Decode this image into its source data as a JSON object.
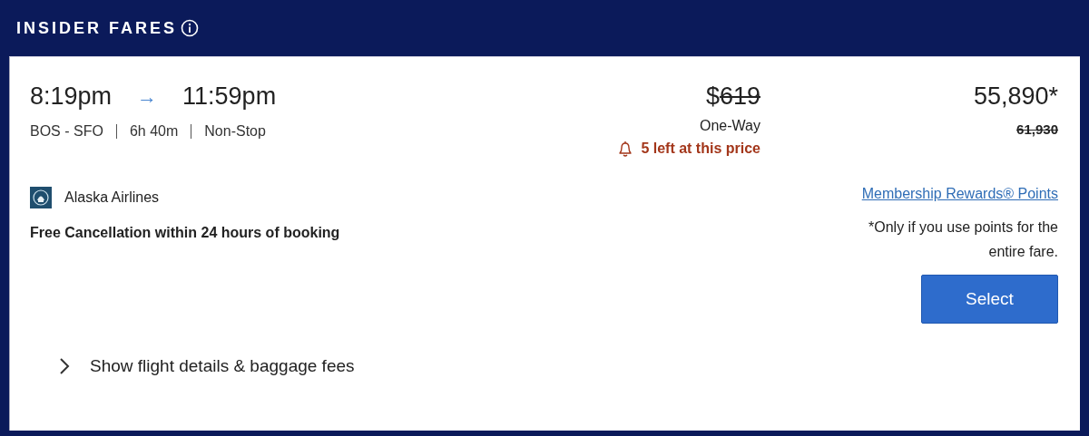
{
  "header": {
    "title": "INSIDER FARES",
    "info": true
  },
  "flight": {
    "depart": "8:19pm",
    "arrow": "→",
    "arrive": "11:59pm",
    "route": "BOS - SFO",
    "duration": "6h 40m",
    "stops": "Non-Stop",
    "airline": "Alaska Airlines",
    "cancellation": "Free Cancellation within 24 hours of booking"
  },
  "price": {
    "currency": "$",
    "amount": "619",
    "struck": true,
    "trip": "One-Way",
    "alert": "5 left at this price"
  },
  "points": {
    "amount": "55,890*",
    "original": "61,930",
    "original_struck": true,
    "program": "Membership Rewards® Points",
    "note": "*Only if you use points for the entire fare.",
    "button": "Select"
  },
  "details": {
    "label": "Show flight details & baggage fees",
    "expanded": false
  }
}
